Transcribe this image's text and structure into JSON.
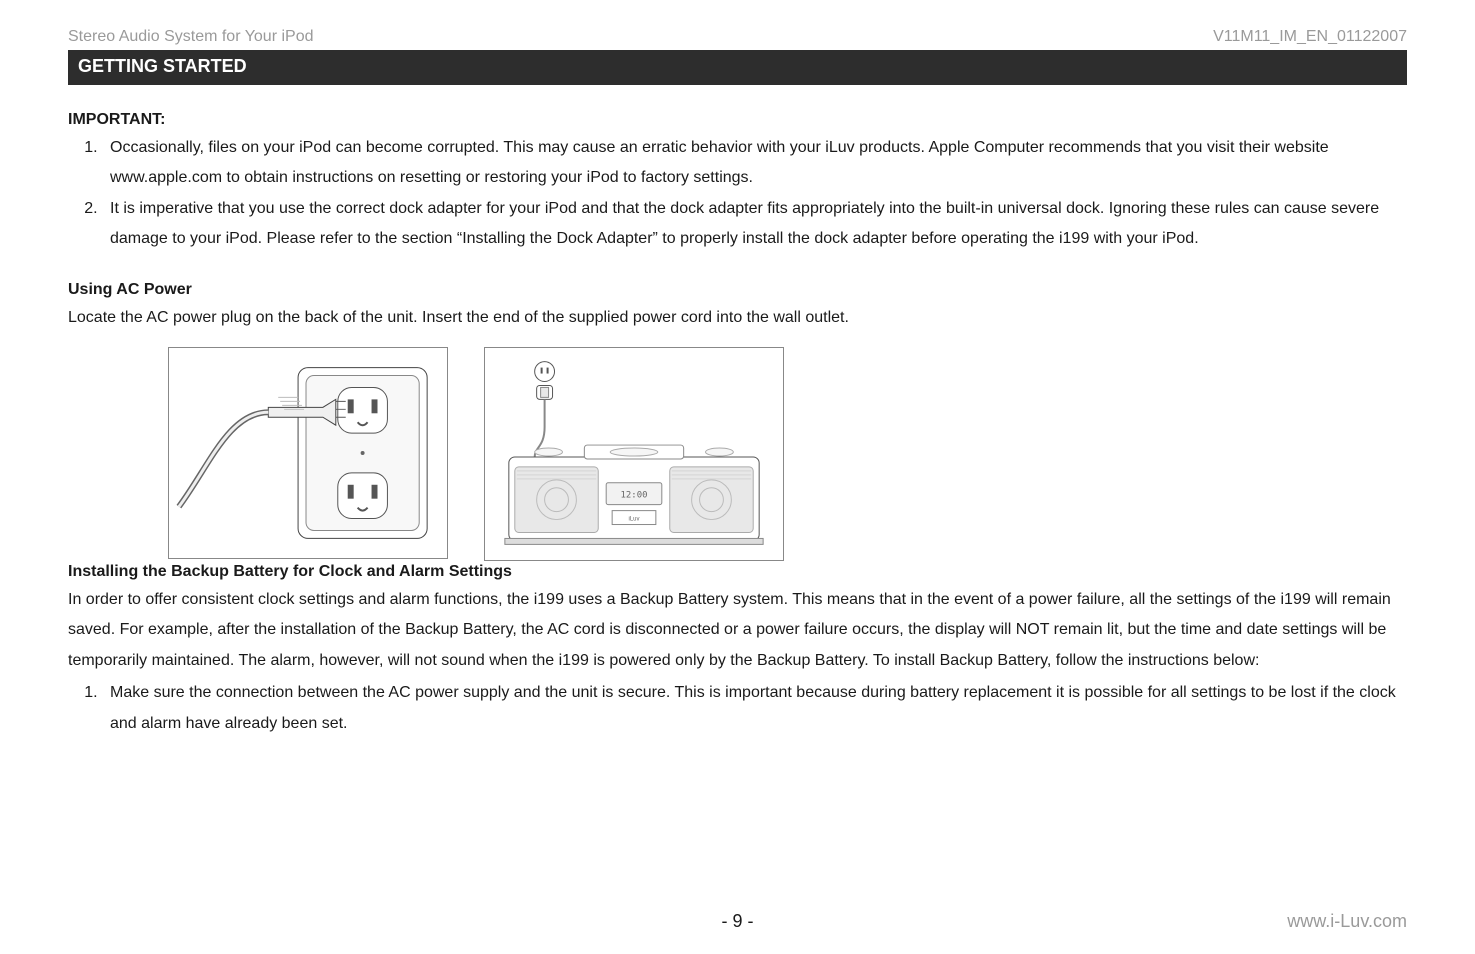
{
  "header": {
    "left": "Stereo Audio System for Your iPod",
    "right": "V11M11_IM_EN_01122007"
  },
  "banner": "GETTING STARTED",
  "important": {
    "heading": "IMPORTANT:",
    "items": [
      "Occasionally, files on your iPod can become corrupted. This may cause an erratic behavior with your iLuv products. Apple Computer recommends that you visit their website www.apple.com to obtain instructions on resetting or restoring your iPod to factory settings.",
      "It is imperative that you use the correct dock adapter for your iPod and that the dock adapter fits appropriately into the built-in universal dock. Ignoring these rules can cause severe damage to your iPod. Please refer to the section “Installing the Dock Adapter” to properly install the dock adapter before operating the i199 with your iPod."
    ]
  },
  "acpower": {
    "heading": "Using AC Power",
    "text": "Locate the AC power plug on the back of the unit. Insert the end of the supplied power cord into the wall outlet."
  },
  "backup": {
    "heading": "Installing the Backup Battery for Clock and Alarm Settings",
    "text": "In order to offer consistent clock settings and alarm functions, the i199 uses a Backup Battery system. This means that in the event of a power failure, all the settings of the i199 will remain saved. For example, after the installation of the Backup Battery, the AC cord is disconnected or a power failure occurs, the display will NOT remain lit, but the time and date settings will be temporarily maintained. The alarm, however, will not sound when the i199 is powered only by the Backup Battery. To install Backup Battery, follow the instructions below:",
    "items": [
      "Make sure the connection between the AC power supply and the unit is secure. This is important because during battery replacement it is possible for all settings to be lost if the clock and alarm have already been set."
    ]
  },
  "footer": {
    "page": "- 9 -",
    "url": "www.i-Luv.com"
  },
  "fig_b_clock": "12:00",
  "fig_b_label": "iLuv"
}
